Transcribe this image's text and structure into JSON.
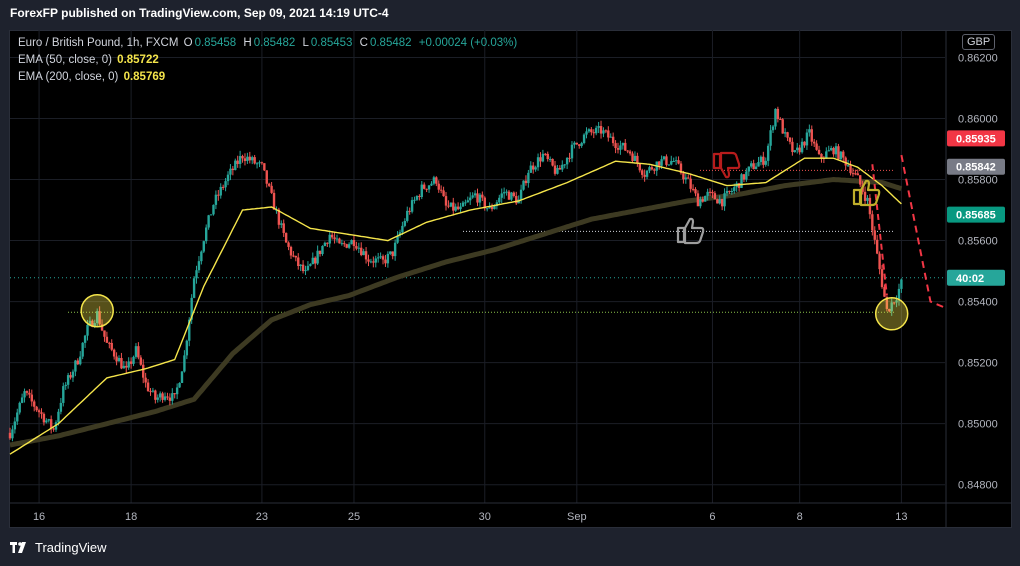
{
  "header": {
    "published_by": "ForexFP published on TradingView.com, Sep 09, 2021 14:19 UTC-4"
  },
  "legend": {
    "symbol": "Euro / British Pound, 1h, FXCM",
    "open_label": "O",
    "open": "0.85458",
    "high_label": "H",
    "high": "0.85482",
    "low_label": "L",
    "low": "0.85453",
    "close_label": "C",
    "close": "0.85482",
    "change": "+0.00024 (+0.03%)",
    "ema50_label": "EMA (50, close, 0)",
    "ema50_value": "0.85722",
    "ema200_label": "EMA (200, close, 0)",
    "ema200_value": "0.85769"
  },
  "currency": "GBP",
  "footer": {
    "brand": "TradingView"
  },
  "colors": {
    "up": "#26a69a",
    "down": "#ef5350",
    "ema50": "#f5e54b",
    "ema200": "#3d3a22",
    "grid": "#1b1e26",
    "bg": "#000000"
  },
  "chart_data": {
    "type": "candlestick",
    "y_ticks": [
      "0.86200",
      "0.86000",
      "0.85800",
      "0.85600",
      "0.85400",
      "0.85200",
      "0.85000",
      "0.84800"
    ],
    "ylim": [
      0.8474,
      0.8629
    ],
    "x_ticks": [
      "16",
      "18",
      "23",
      "25",
      "30",
      "Sep",
      "6",
      "8",
      "13"
    ],
    "price_labels": [
      {
        "text": "0.85935",
        "value": 0.85935,
        "color": "#f23645"
      },
      {
        "text": "0.85842",
        "value": 0.85842,
        "color": "#787b86"
      },
      {
        "text": "0.85685",
        "value": 0.85685,
        "color": "#089981"
      },
      {
        "text": "40:02",
        "value": 0.85478,
        "color": "#26a69a"
      }
    ],
    "horizontal_levels": [
      0.85365,
      0.8563,
      0.85478,
      0.8583
    ],
    "price_path": [
      [
        0,
        0.8497
      ],
      [
        3,
        0.851
      ],
      [
        6,
        0.8504
      ],
      [
        9,
        0.8498
      ],
      [
        11,
        0.8511
      ],
      [
        14,
        0.8521
      ],
      [
        16,
        0.8531
      ],
      [
        18,
        0.8536
      ],
      [
        20,
        0.8526
      ],
      [
        22,
        0.8522
      ],
      [
        24,
        0.8517
      ],
      [
        26,
        0.8524
      ],
      [
        28,
        0.8513
      ],
      [
        30,
        0.8508
      ],
      [
        32,
        0.851
      ],
      [
        34,
        0.8508
      ],
      [
        36,
        0.8522
      ],
      [
        38,
        0.8548
      ],
      [
        40,
        0.8561
      ],
      [
        42,
        0.8572
      ],
      [
        45,
        0.8581
      ],
      [
        48,
        0.8588
      ],
      [
        50,
        0.8586
      ],
      [
        52,
        0.8584
      ],
      [
        54,
        0.8574
      ],
      [
        57,
        0.8559
      ],
      [
        59,
        0.8553
      ],
      [
        61,
        0.8549
      ],
      [
        63,
        0.8554
      ],
      [
        66,
        0.8562
      ],
      [
        68,
        0.8558
      ],
      [
        71,
        0.856
      ],
      [
        74,
        0.8554
      ],
      [
        77,
        0.8553
      ],
      [
        79,
        0.8556
      ],
      [
        82,
        0.8569
      ],
      [
        85,
        0.8577
      ],
      [
        88,
        0.858
      ],
      [
        90,
        0.8571
      ],
      [
        93,
        0.857
      ],
      [
        96,
        0.8575
      ],
      [
        99,
        0.857
      ],
      [
        102,
        0.8576
      ],
      [
        105,
        0.8573
      ],
      [
        107,
        0.8583
      ],
      [
        110,
        0.8588
      ],
      [
        113,
        0.8582
      ],
      [
        116,
        0.859
      ],
      [
        119,
        0.8595
      ],
      [
        122,
        0.8596
      ],
      [
        125,
        0.8592
      ],
      [
        128,
        0.8589
      ],
      [
        131,
        0.8582
      ],
      [
        134,
        0.8586
      ],
      [
        137,
        0.8586
      ],
      [
        140,
        0.8579
      ],
      [
        142,
        0.8573
      ],
      [
        144,
        0.8575
      ],
      [
        147,
        0.8573
      ],
      [
        150,
        0.8578
      ],
      [
        153,
        0.8584
      ],
      [
        156,
        0.8587
      ],
      [
        158,
        0.8603
      ],
      [
        160,
        0.8594
      ],
      [
        162,
        0.8588
      ],
      [
        165,
        0.8595
      ],
      [
        167,
        0.8587
      ],
      [
        170,
        0.859
      ],
      [
        173,
        0.8585
      ],
      [
        175,
        0.858
      ],
      [
        177,
        0.8573
      ],
      [
        179,
        0.8555
      ],
      [
        181,
        0.8537
      ],
      [
        183,
        0.8542
      ],
      [
        184,
        0.8546
      ]
    ],
    "ema50_path": [
      [
        0,
        0.849
      ],
      [
        10,
        0.85
      ],
      [
        20,
        0.8515
      ],
      [
        28,
        0.8518
      ],
      [
        34,
        0.8521
      ],
      [
        40,
        0.8545
      ],
      [
        48,
        0.857
      ],
      [
        54,
        0.8571
      ],
      [
        62,
        0.8564
      ],
      [
        70,
        0.8562
      ],
      [
        78,
        0.856
      ],
      [
        86,
        0.8566
      ],
      [
        95,
        0.857
      ],
      [
        105,
        0.8573
      ],
      [
        115,
        0.8579
      ],
      [
        125,
        0.8586
      ],
      [
        132,
        0.8585
      ],
      [
        140,
        0.8582
      ],
      [
        148,
        0.8578
      ],
      [
        156,
        0.8579
      ],
      [
        164,
        0.8587
      ],
      [
        170,
        0.8587
      ],
      [
        175,
        0.8584
      ],
      [
        180,
        0.8578
      ],
      [
        184,
        0.8572
      ]
    ],
    "ema200_path": [
      [
        0,
        0.8493
      ],
      [
        10,
        0.8496
      ],
      [
        20,
        0.85
      ],
      [
        30,
        0.8504
      ],
      [
        38,
        0.8508
      ],
      [
        46,
        0.8523
      ],
      [
        54,
        0.8534
      ],
      [
        62,
        0.8539
      ],
      [
        70,
        0.8542
      ],
      [
        80,
        0.8548
      ],
      [
        90,
        0.8553
      ],
      [
        100,
        0.8557
      ],
      [
        110,
        0.8562
      ],
      [
        120,
        0.8567
      ],
      [
        130,
        0.857
      ],
      [
        140,
        0.8573
      ],
      [
        150,
        0.8575
      ],
      [
        160,
        0.8578
      ],
      [
        170,
        0.858
      ],
      [
        180,
        0.8579
      ],
      [
        184,
        0.8577
      ]
    ],
    "projection_path": [
      [
        184,
        0.8588
      ],
      [
        187,
        0.8564
      ],
      [
        190,
        0.854
      ],
      [
        193,
        0.8538
      ]
    ],
    "circles": [
      {
        "x": 18,
        "y": 0.8537
      },
      {
        "x": 182,
        "y": 0.8536
      }
    ]
  }
}
